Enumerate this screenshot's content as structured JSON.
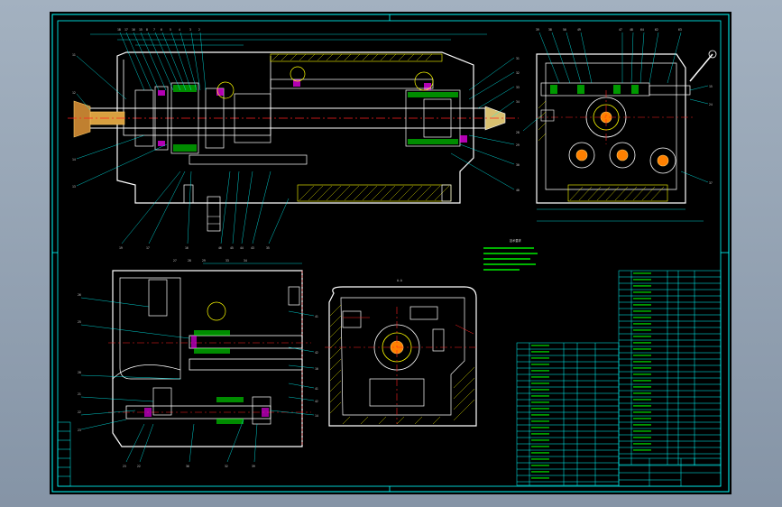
{
  "drawing": {
    "title_block_label": "",
    "notes_heading": "",
    "notes": []
  },
  "colors": {
    "frame": "#00ffff",
    "centerline": "#ff2020",
    "part": "#ffffff",
    "hatch": "#ffff00",
    "detail": "#00ff00",
    "accent": "#ff00ff",
    "background": "#000000"
  }
}
